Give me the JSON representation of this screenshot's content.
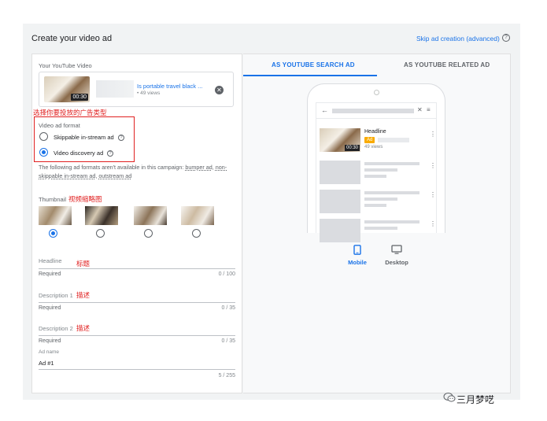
{
  "header": {
    "title": "Create your video ad",
    "skip_link": "Skip ad creation (advanced)"
  },
  "left_panel": {
    "video_section_label": "Your YouTube Video",
    "video": {
      "title": "Is portable travel black ...",
      "views": "• 49 views",
      "duration": "00:30"
    },
    "format_annotation": "选择你要投放的广告类型",
    "format_label": "Video ad format",
    "format_options": [
      {
        "label": "Skippable in-stream ad",
        "selected": false
      },
      {
        "label": "Video discovery ad",
        "selected": true
      }
    ],
    "note_prefix": "The following ad formats aren't available in this campaign:",
    "note_links": [
      "bumper ad",
      "non-skippable in-stream ad",
      "outstream ad"
    ],
    "thumbnail_label": "Thumbnail",
    "thumbnail_annotation": "视频缩略图",
    "thumbnails_selected_index": 0,
    "fields": [
      {
        "label": "Headline",
        "annotation": "标题",
        "helper": "Required",
        "count": "0 / 100"
      },
      {
        "label": "Description 1",
        "annotation": "描述",
        "helper": "Required",
        "count": "0 / 35"
      },
      {
        "label": "Description 2",
        "annotation": "描述",
        "helper": "Required",
        "count": "0 / 35"
      }
    ],
    "ad_name_label": "Ad name",
    "ad_name_value": "Ad #1",
    "ad_name_count": "5 / 255"
  },
  "right_panel": {
    "tabs": [
      {
        "label": "AS YOUTUBE SEARCH AD",
        "active": true
      },
      {
        "label": "AS YOUTUBE RELATED AD",
        "active": false
      }
    ],
    "preview": {
      "headline": "Headline",
      "badge": "Ad",
      "views": "49 views",
      "duration": "00:30"
    },
    "devices": [
      {
        "label": "Mobile",
        "active": true,
        "icon": "mobile-icon"
      },
      {
        "label": "Desktop",
        "active": false,
        "icon": "desktop-icon"
      }
    ]
  },
  "watermark": "三月梦呓",
  "colors": {
    "accent": "#1a73e8",
    "annotation": "#e02020",
    "ad_badge": "#f9ab00"
  }
}
